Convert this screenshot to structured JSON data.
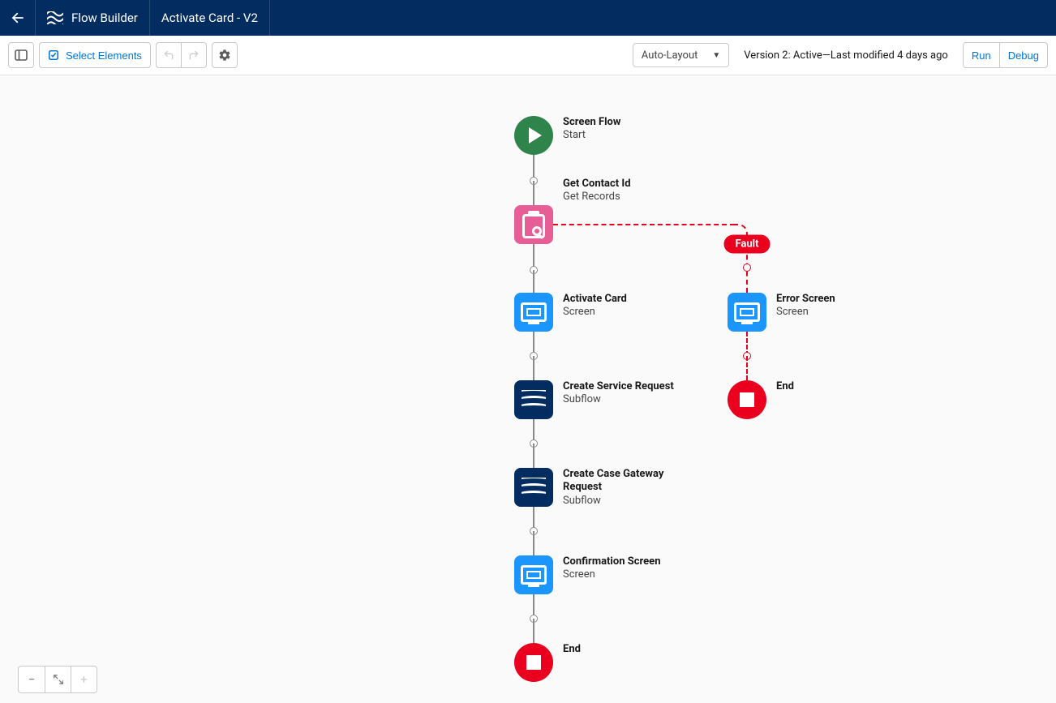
{
  "header": {
    "brand_label": "Flow Builder",
    "page_title": "Activate Card - V2"
  },
  "toolbar": {
    "select_elements_label": "Select Elements",
    "layout_mode": "Auto-Layout",
    "status_text": "Version 2: Active—Last modified 4 days ago",
    "run_label": "Run",
    "debug_label": "Debug"
  },
  "nodes": {
    "start": {
      "title": "Screen Flow",
      "subtitle": "Start"
    },
    "get_contact": {
      "title": "Get Contact Id",
      "subtitle": "Get Records"
    },
    "activate_card": {
      "title": "Activate Card",
      "subtitle": "Screen"
    },
    "create_service": {
      "title": "Create Service Request",
      "subtitle": "Subflow"
    },
    "create_gateway": {
      "title": "Create Case Gateway Request",
      "subtitle": "Subflow"
    },
    "confirmation": {
      "title": "Confirmation Screen",
      "subtitle": "Screen"
    },
    "end_main": {
      "title": "End"
    },
    "error_screen": {
      "title": "Error Screen",
      "subtitle": "Screen"
    },
    "end_error": {
      "title": "End"
    }
  },
  "labels": {
    "fault": "Fault"
  }
}
